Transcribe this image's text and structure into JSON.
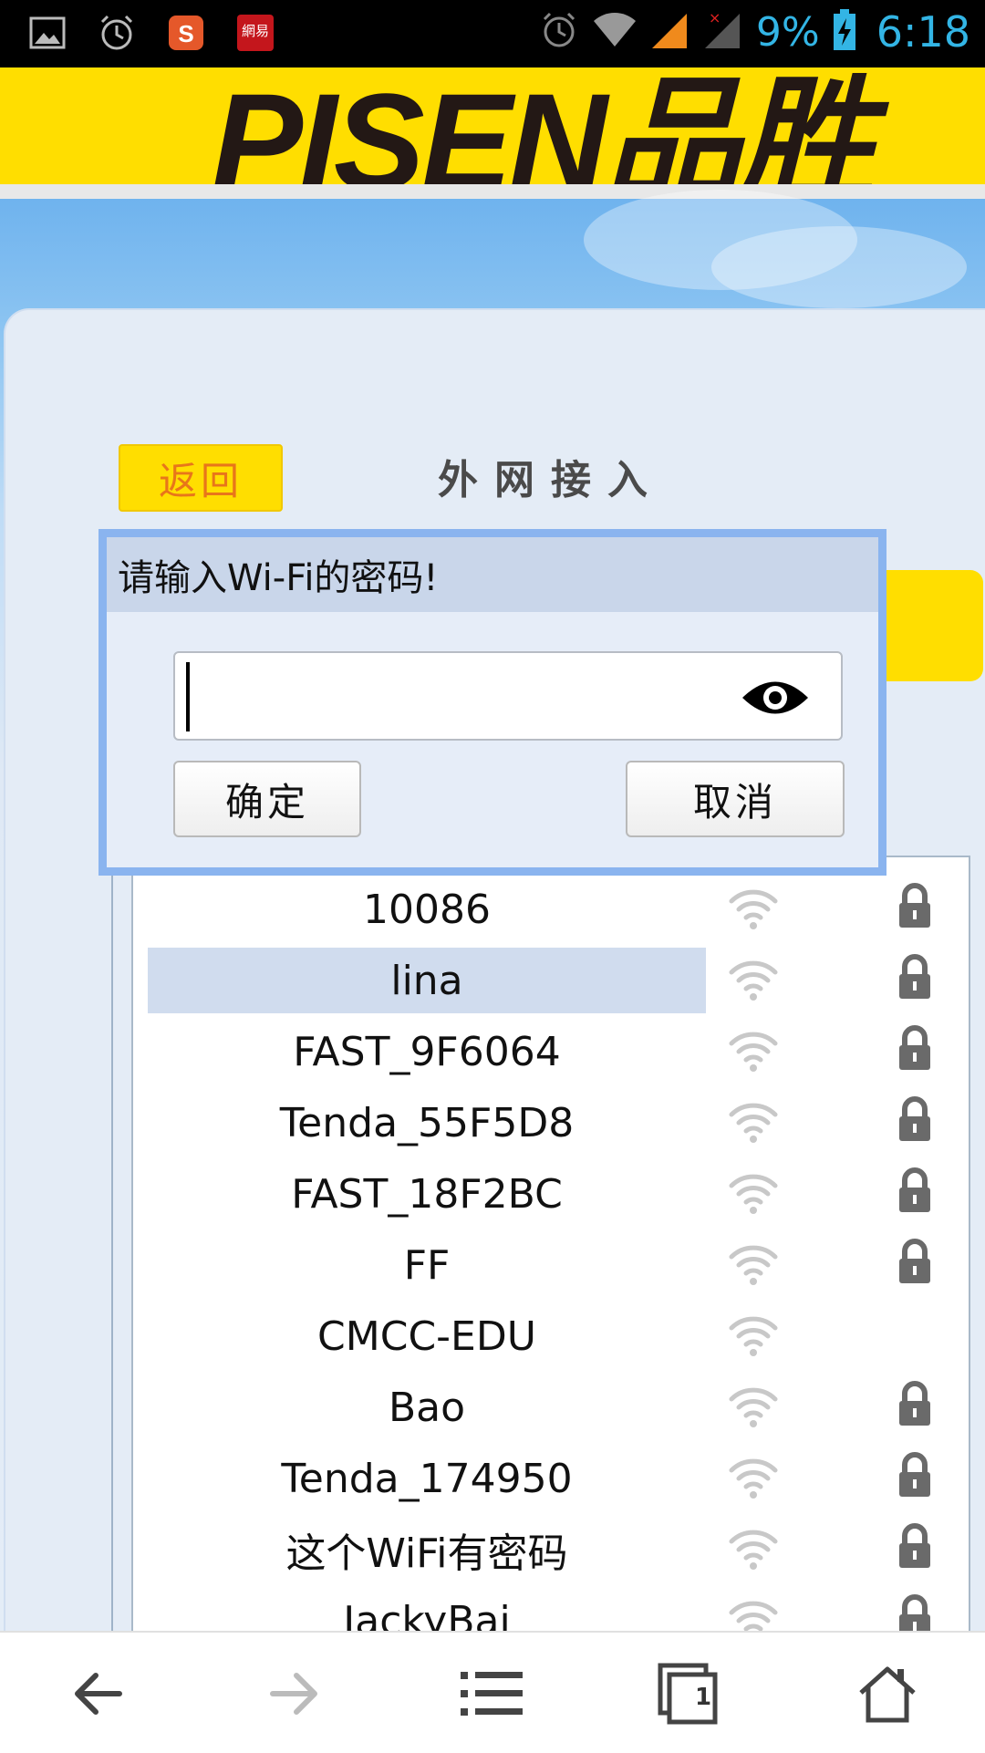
{
  "status_bar": {
    "icons_left": [
      "gallery-icon",
      "alarm-icon",
      "sogou-icon",
      "netease-icon"
    ],
    "netease_label": "網易",
    "battery_percent": "9%",
    "time": "6:18"
  },
  "brand": {
    "logo_text": "PISEN品胜"
  },
  "page": {
    "back_label": "返回",
    "title": "外网接入"
  },
  "dialog": {
    "title": "请输入Wi-Fi的密码!",
    "password_value": "",
    "ok_label": "确定",
    "cancel_label": "取消"
  },
  "wifi_list": [
    {
      "name": "10086",
      "locked": true,
      "selected": false
    },
    {
      "name": "lina",
      "locked": true,
      "selected": true
    },
    {
      "name": "FAST_9F6064",
      "locked": true,
      "selected": false
    },
    {
      "name": "Tenda_55F5D8",
      "locked": true,
      "selected": false
    },
    {
      "name": "FAST_18F2BC",
      "locked": true,
      "selected": false
    },
    {
      "name": "FF",
      "locked": true,
      "selected": false
    },
    {
      "name": "CMCC-EDU",
      "locked": false,
      "selected": false
    },
    {
      "name": "Bao",
      "locked": true,
      "selected": false
    },
    {
      "name": "Tenda_174950",
      "locked": true,
      "selected": false
    },
    {
      "name": "这个WiFi有密码",
      "locked": true,
      "selected": false
    },
    {
      "name": "JackyBai",
      "locked": true,
      "selected": false
    }
  ],
  "bottom_nav": {
    "items": [
      "back-icon",
      "forward-icon",
      "menu-icon",
      "tabs-icon",
      "home-icon"
    ],
    "tab_count": "1"
  },
  "colors": {
    "brand_yellow": "#ffde00",
    "back_text": "#e8761a",
    "status_blue": "#33b5e5",
    "dialog_border": "#8ab4ef"
  }
}
